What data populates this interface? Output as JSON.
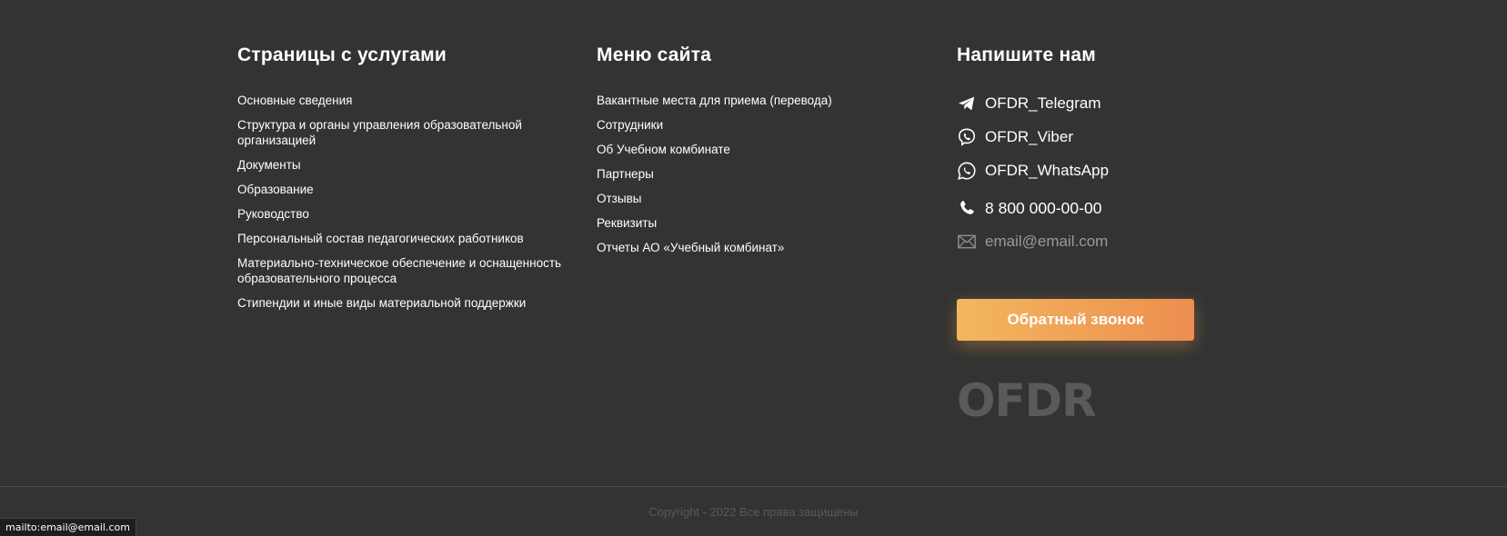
{
  "services": {
    "title": "Страницы с услугами",
    "items": [
      {
        "label": "Основные сведения"
      },
      {
        "label": "Структура и органы управления образовательной организацией"
      },
      {
        "label": "Документы"
      },
      {
        "label": "Образование"
      },
      {
        "label": "Руководство"
      },
      {
        "label": "Персональный состав педагогических работников"
      },
      {
        "label": "Материально-техническое обеспечение и оснащенность образовательного процесса"
      },
      {
        "label": "Стипендии и иные виды материальной поддержки"
      }
    ]
  },
  "menu": {
    "title": "Меню сайта",
    "items": [
      {
        "label": "Вакантные места для приема (перевода)"
      },
      {
        "label": "Сотрудники"
      },
      {
        "label": "Об Учебном комбинате"
      },
      {
        "label": "Партнеры"
      },
      {
        "label": "Отзывы"
      },
      {
        "label": "Реквизиты"
      },
      {
        "label": "Отчеты АО «Учебный комбинат»"
      }
    ]
  },
  "contact": {
    "title": "Напишите нам",
    "telegram": {
      "label": "OFDR_Telegram",
      "icon": "telegram-icon"
    },
    "viber": {
      "label": "OFDR_Viber",
      "icon": "viber-icon"
    },
    "whatsapp": {
      "label": "OFDR_WhatsApp",
      "icon": "whatsapp-icon"
    },
    "phone": {
      "label": "8 800 000-00-00",
      "icon": "phone-icon"
    },
    "email": {
      "label": "email@email.com",
      "icon": "mail-icon"
    },
    "callback_label": "Обратный звонок"
  },
  "logo": {
    "text": "OFDR"
  },
  "copyright": "Copyright - 2022 Все права защищены",
  "statusbar": "mailto:email@email.com",
  "colors": {
    "background": "#333333",
    "accent_start": "#f3b75e",
    "accent_end": "#ec8e4f",
    "muted_text": "#9a9a9a"
  }
}
